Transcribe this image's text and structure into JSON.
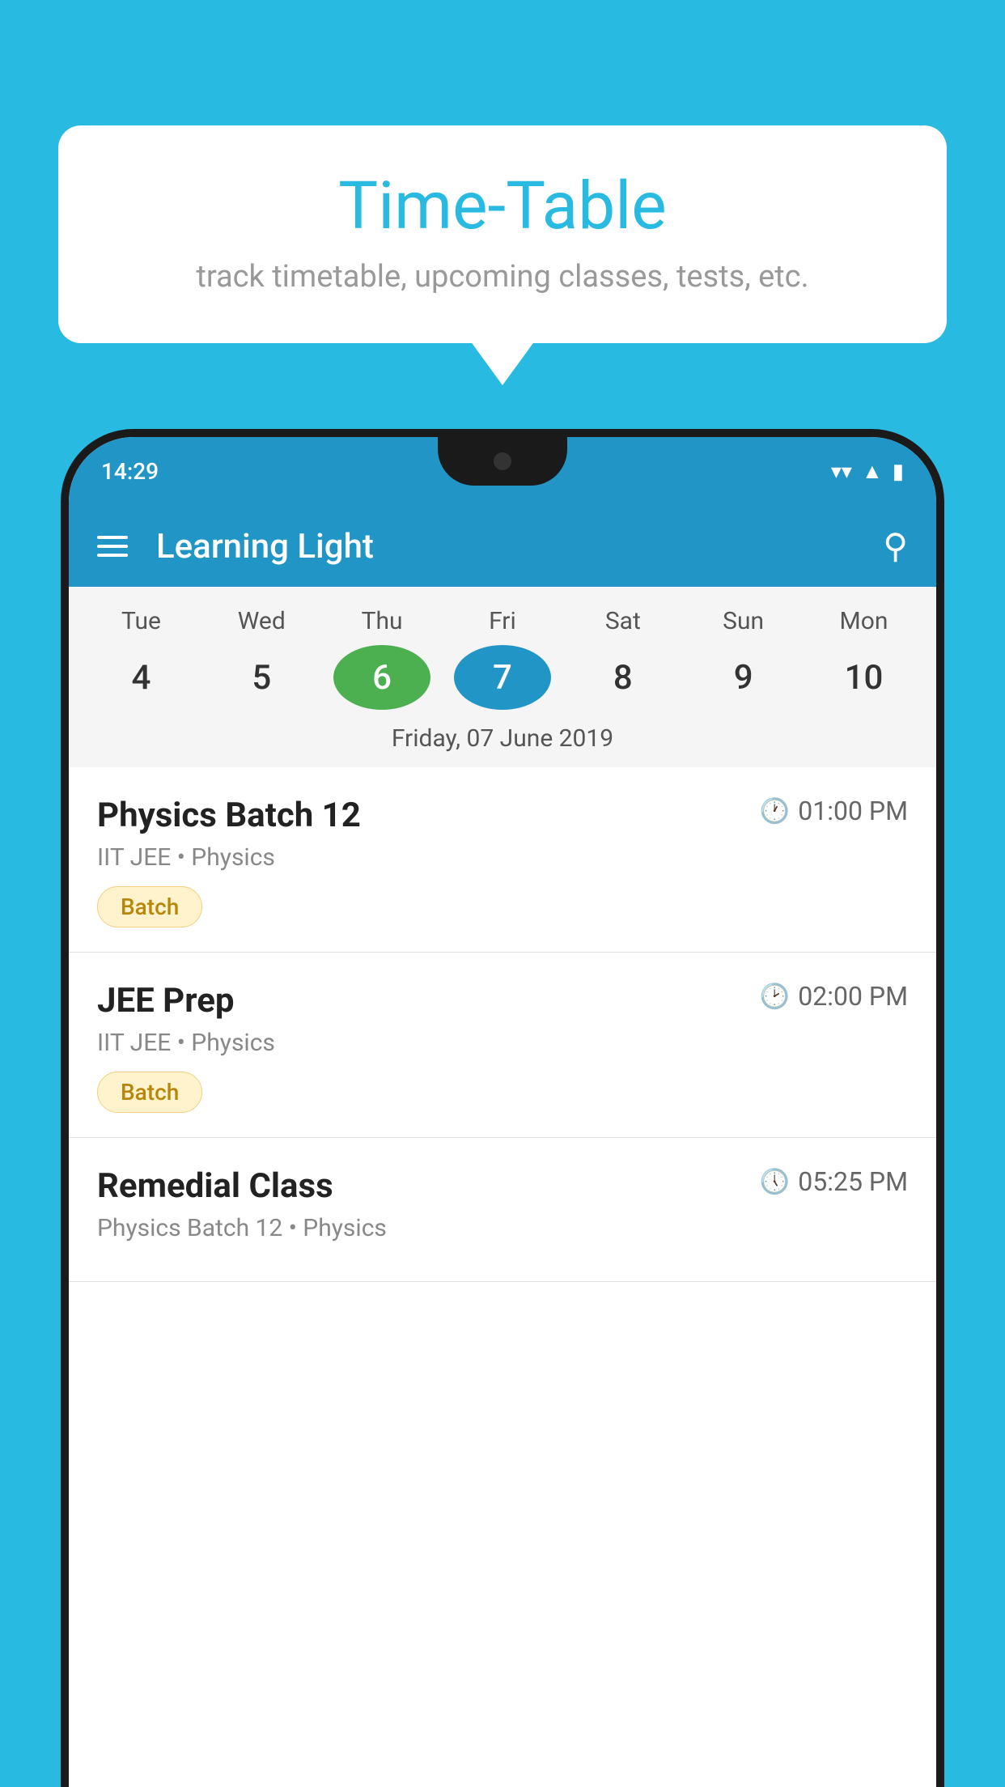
{
  "background_color": "#29BAE2",
  "tooltip": {
    "title": "Time-Table",
    "subtitle": "track timetable, upcoming classes, tests, etc."
  },
  "phone": {
    "status_bar": {
      "time": "14:29"
    },
    "app_bar": {
      "title": "Learning Light"
    },
    "calendar": {
      "days": [
        {
          "name": "Tue",
          "num": "4"
        },
        {
          "name": "Wed",
          "num": "5"
        },
        {
          "name": "Thu",
          "num": "6",
          "state": "today"
        },
        {
          "name": "Fri",
          "num": "7",
          "state": "selected"
        },
        {
          "name": "Sat",
          "num": "8"
        },
        {
          "name": "Sun",
          "num": "9"
        },
        {
          "name": "Mon",
          "num": "10"
        }
      ],
      "selected_date_label": "Friday, 07 June 2019"
    },
    "schedule": [
      {
        "title": "Physics Batch 12",
        "time": "01:00 PM",
        "subtitle": "IIT JEE • Physics",
        "badge": "Batch"
      },
      {
        "title": "JEE Prep",
        "time": "02:00 PM",
        "subtitle": "IIT JEE • Physics",
        "badge": "Batch"
      },
      {
        "title": "Remedial Class",
        "time": "05:25 PM",
        "subtitle": "Physics Batch 12 • Physics",
        "badge": null
      }
    ]
  }
}
